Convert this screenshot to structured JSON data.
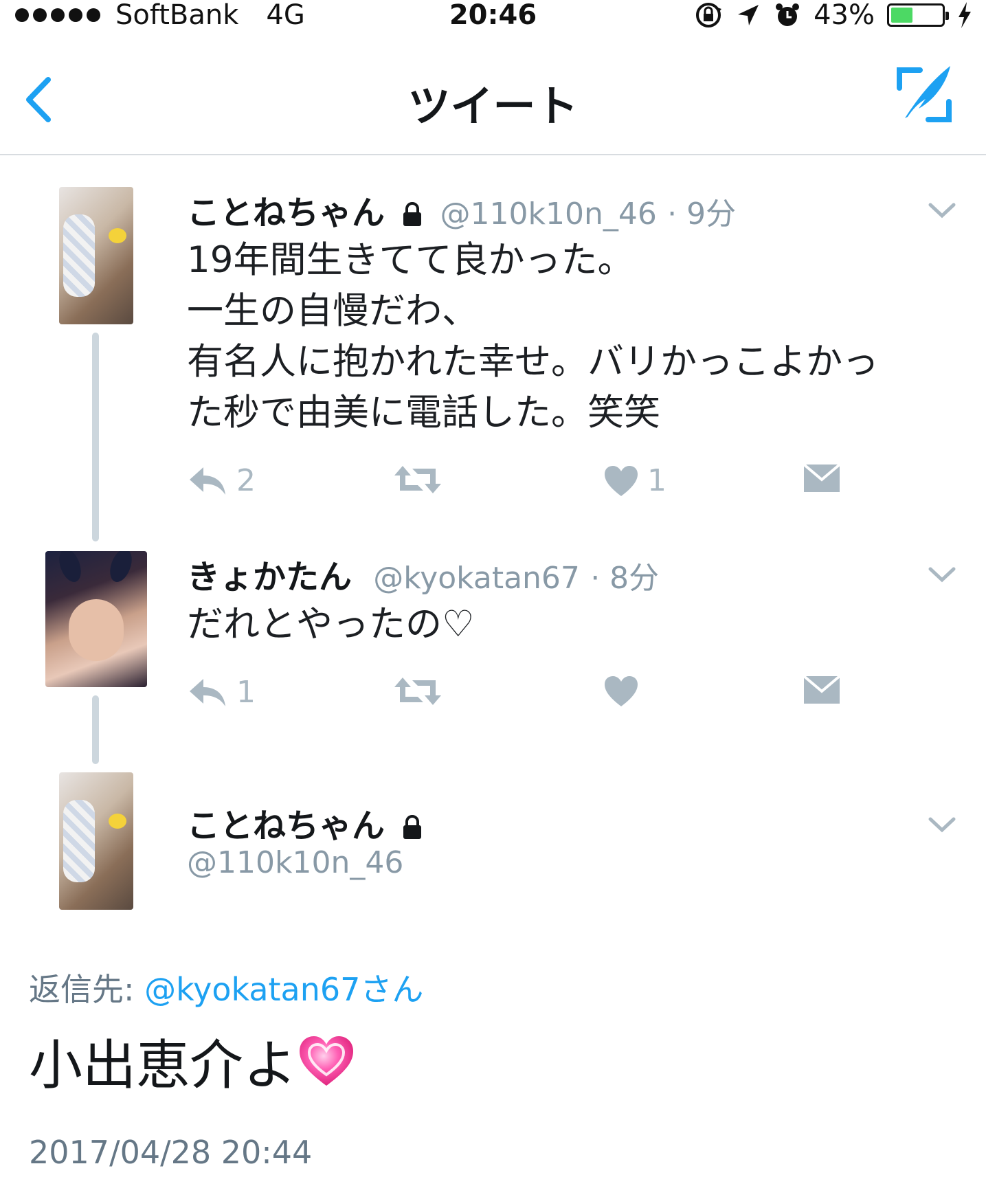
{
  "status_bar": {
    "carrier": "SoftBank",
    "network": "4G",
    "time": "20:46",
    "battery_percent": "43%",
    "battery_level": 0.43,
    "signal_dots": 5
  },
  "nav": {
    "title": "ツイート",
    "back_icon": "chevron-left-icon",
    "compose_icon": "compose-quill-icon"
  },
  "colors": {
    "accent": "#1da1f2",
    "muted": "#8899a6",
    "battery_green": "#4cd964"
  },
  "tweets": [
    {
      "name": "ことねちゃん",
      "protected": true,
      "handle": "@110k10n_46",
      "time": "· 9分",
      "lines": [
        "19年間生きてて良かった。",
        "一生の自慢だわ、",
        "有名人に抱かれた幸せ。バリかっこよかっ",
        "た秒で由美に電話した。笑笑"
      ],
      "reply_count": "2",
      "like_count": "1"
    },
    {
      "name": "きょかたん",
      "handle": "@kyokatan67",
      "time": "· 8分",
      "lines": [
        "だれとやったの♡"
      ],
      "reply_count": "1"
    }
  ],
  "focused_tweet": {
    "name": "ことねちゃん",
    "protected": true,
    "handle": "@110k10n_46",
    "reply_to_label": "返信先:",
    "reply_to_mention": "@kyokatan67さん",
    "text": "小出恵介よ",
    "emoji": "heart-icon",
    "timestamp": "2017/04/28 20:44"
  }
}
